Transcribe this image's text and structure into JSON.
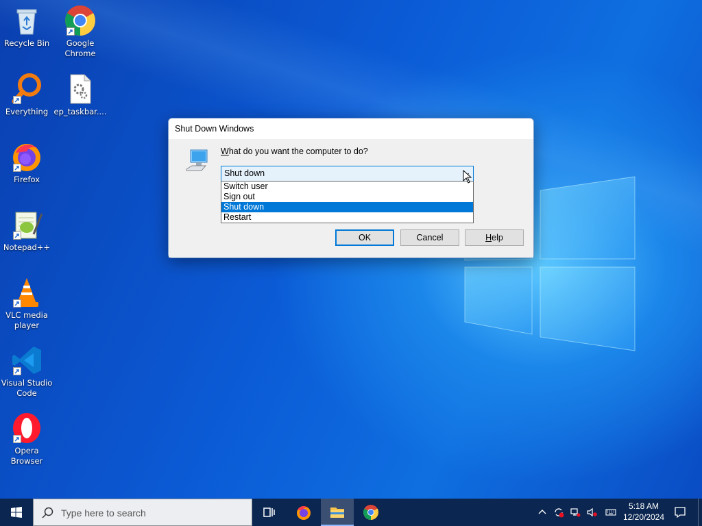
{
  "desktop": {
    "icons": [
      {
        "label": "Recycle Bin",
        "icon": "recycle-bin-icon"
      },
      {
        "label": "Google Chrome",
        "icon": "chrome-icon"
      },
      {
        "label": "Everything",
        "icon": "everything-icon"
      },
      {
        "label": "ep_taskbar....",
        "icon": "settings-file-icon"
      },
      {
        "label": "Firefox",
        "icon": "firefox-icon"
      },
      {
        "label": "Notepad++",
        "icon": "notepadpp-icon"
      },
      {
        "label": "VLC media player",
        "icon": "vlc-icon"
      },
      {
        "label": "Visual Studio Code",
        "icon": "vscode-icon"
      },
      {
        "label": "Opera Browser",
        "icon": "opera-icon"
      }
    ]
  },
  "dialog": {
    "title": "Shut Down Windows",
    "question_prefix": "W",
    "question_rest": "hat do you want the computer to do?",
    "selected": "Shut down",
    "options": [
      "Switch user",
      "Sign out",
      "Shut down",
      "Restart"
    ],
    "highlighted_option": "Shut down",
    "ok_label": "OK",
    "cancel_label": "Cancel",
    "help_prefix": "H",
    "help_rest": "elp"
  },
  "taskbar": {
    "search_placeholder": "Type here to search",
    "time": "5:18 AM",
    "date": "12/20/2024",
    "apps": [
      "task-view-icon",
      "firefox-icon",
      "file-explorer-icon",
      "chrome-icon"
    ],
    "active_app": "file-explorer-icon"
  },
  "colors": {
    "accent": "#0078d7",
    "taskbar": "#0b2650",
    "dialog_bg": "#f0f0f0"
  }
}
